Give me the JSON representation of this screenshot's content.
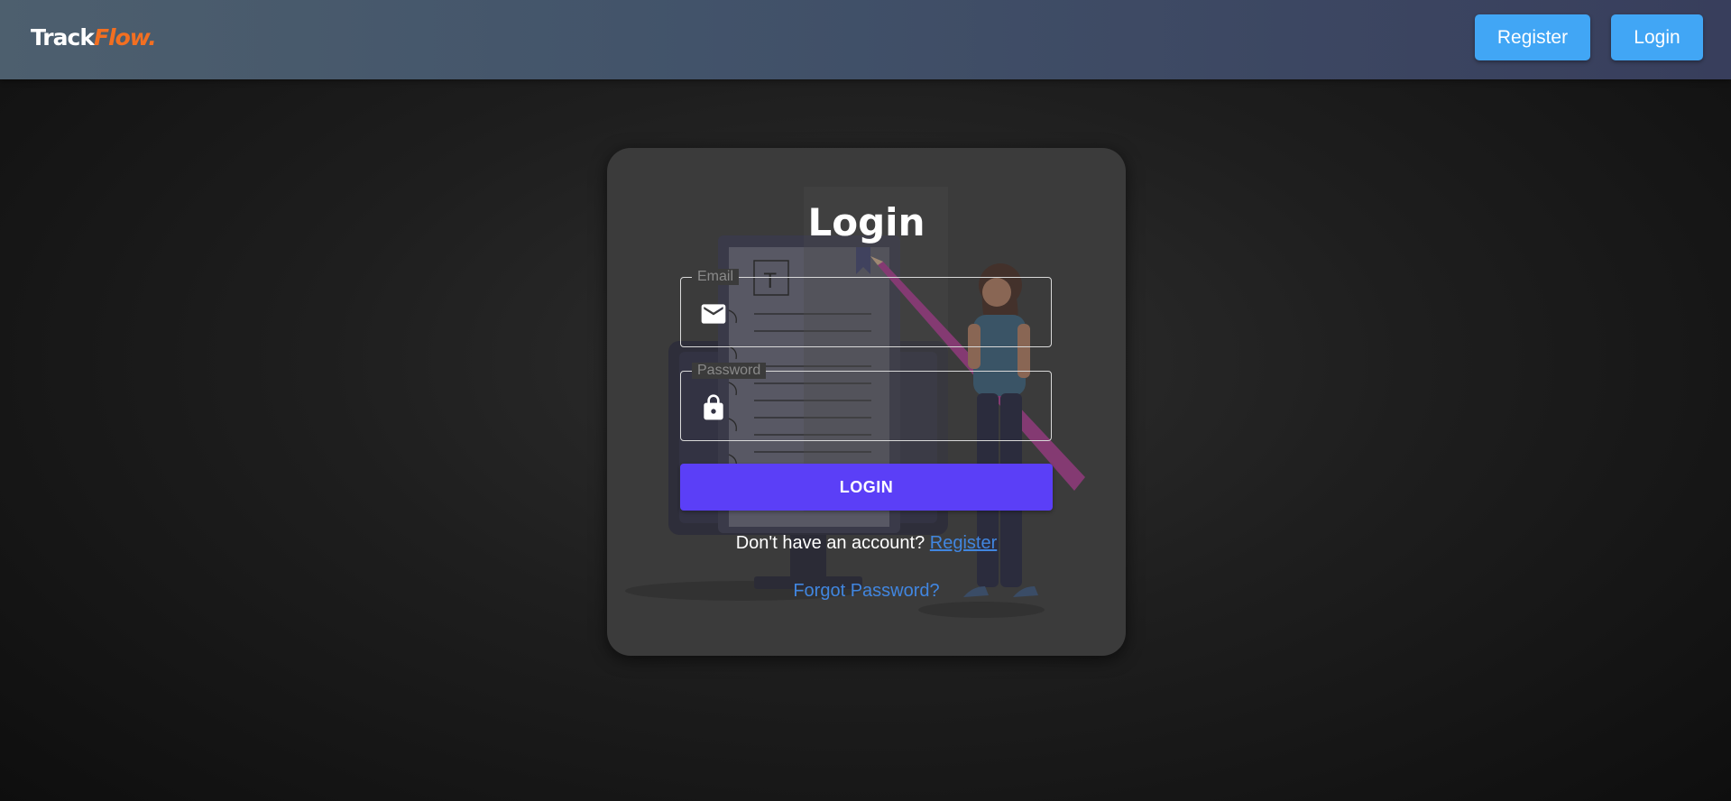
{
  "navbar": {
    "logo_main": "Track",
    "logo_accent": "Flow.",
    "register_label": "Register",
    "login_label": "Login"
  },
  "form": {
    "title": "Login",
    "email": {
      "label": "Email",
      "value": "",
      "icon": "envelope-icon"
    },
    "password": {
      "label": "Password",
      "value": "",
      "icon": "lock-icon"
    },
    "submit_label": "LOGIN",
    "no_account_text": "Don't have an account?",
    "register_link": "Register",
    "forgot_link": "Forgot Password?"
  },
  "colors": {
    "navbar_gradient_start": "#4d5f6e",
    "navbar_gradient_end": "#383e5c",
    "nav_button": "#41a6f5",
    "logo_accent": "#f36f21",
    "card_background": "#3b3b3b",
    "submit_button": "#5b3ff7",
    "link": "#4186e0"
  }
}
